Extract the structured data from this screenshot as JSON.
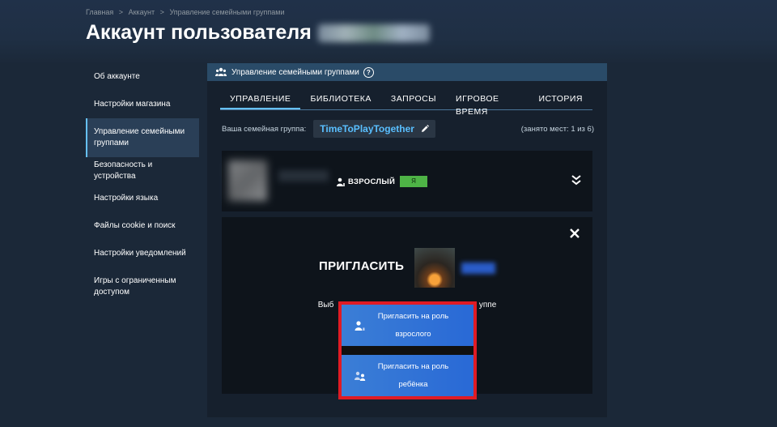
{
  "breadcrumb": [
    "Главная",
    ">",
    "Аккаунт",
    ">",
    "Управление семейными группами"
  ],
  "page": {
    "title": "Аккаунт пользователя"
  },
  "sidebar": {
    "items": [
      {
        "label": "Об аккаунте",
        "active": false
      },
      {
        "label": "Настройки магазина",
        "active": false
      },
      {
        "label": "Управление семейными группами",
        "active": true
      },
      {
        "label": "Безопасность и устройства",
        "active": false
      },
      {
        "label": "Настройки языка",
        "active": false
      },
      {
        "label": "Файлы cookie и поиск",
        "active": false
      },
      {
        "label": "Настройки уведомлений",
        "active": false
      },
      {
        "label": "Игры с ограниченным доступом",
        "active": false
      }
    ]
  },
  "panel": {
    "header": "Управление семейными группами",
    "help_icon": "?",
    "tabs": [
      {
        "label": "УПРАВЛЕНИЕ",
        "active": true
      },
      {
        "label": "БИБЛИОТЕКА",
        "active": false
      },
      {
        "label": "ЗАПРОСЫ",
        "active": false
      },
      {
        "label": "ИГРОВОЕ ВРЕМЯ",
        "active": false
      },
      {
        "label": "ИСТОРИЯ",
        "active": false
      }
    ],
    "group_label": "Ваша семейная группа:",
    "group_name": "TimeToPlayTogether",
    "slots": "(занято мест: 1 из 6)"
  },
  "member": {
    "role": "ВЗРОСЛЫЙ",
    "badge": "Я"
  },
  "invite": {
    "title": "ПРИГЛАСИТЬ",
    "choose_text_left": "Выб",
    "choose_text_right": "уппе",
    "buttons": [
      {
        "label_line1": "Пригласить на роль",
        "label_line2": "взрослого"
      },
      {
        "label_line1": "Пригласить на роль",
        "label_line2": "ребёнка"
      }
    ]
  },
  "colors": {
    "background": "#1b2838",
    "accent": "#66c0f4",
    "group_name": "#59bfff",
    "badge": "#4eb346",
    "invite_button": "#2969d6",
    "highlight_border": "#e01b24"
  }
}
